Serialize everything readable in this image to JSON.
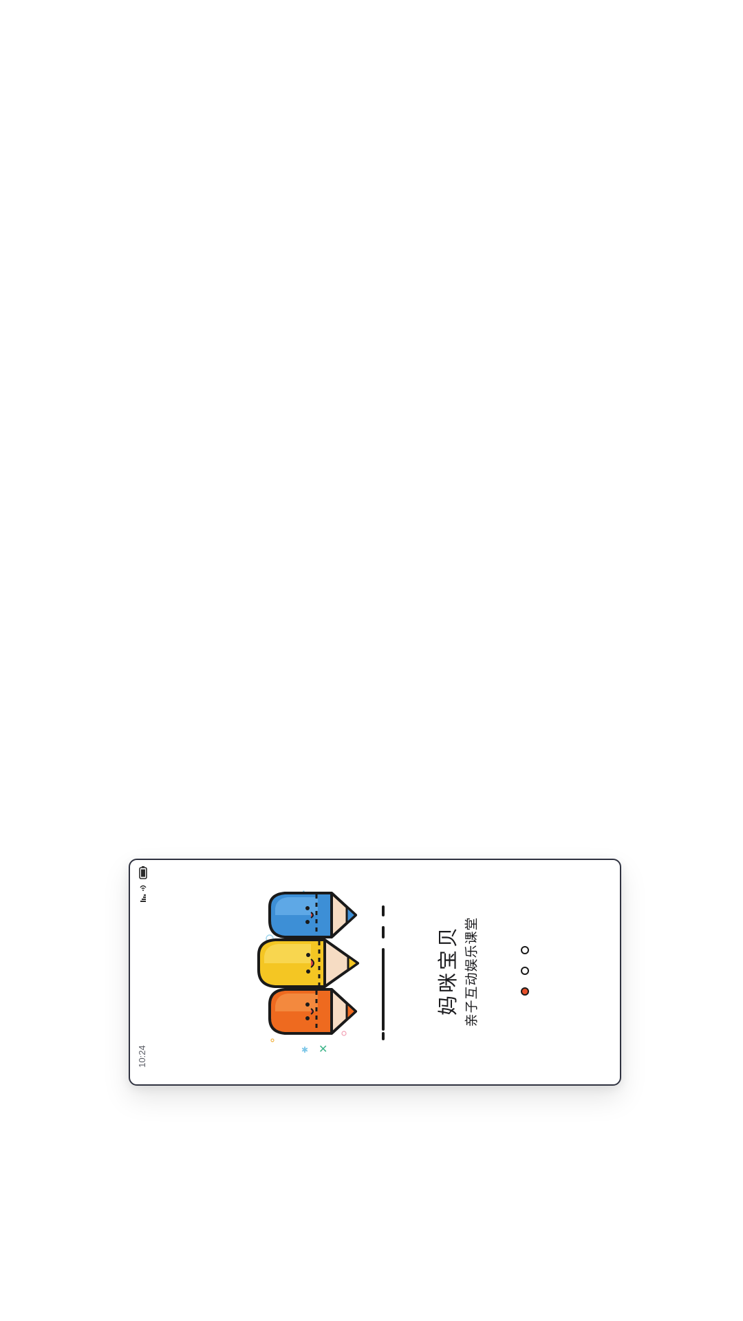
{
  "status_bar": {
    "time": "10:24",
    "icons": [
      "signal-icon",
      "wifi-icon",
      "battery-icon"
    ]
  },
  "onboarding": {
    "illustration": "three-pencils-illustration",
    "title": "妈咪宝贝",
    "subtitle": "亲子互动娱乐课堂",
    "page_indicator": {
      "total": 3,
      "active_index": 2
    }
  },
  "colors": {
    "frame_border": "#2f3240",
    "accent": "#e8502a",
    "pencil_blue": "#3d8fd6",
    "pencil_yellow": "#f4c623",
    "pencil_orange": "#ee6a1f",
    "text": "#1c1c1f"
  }
}
